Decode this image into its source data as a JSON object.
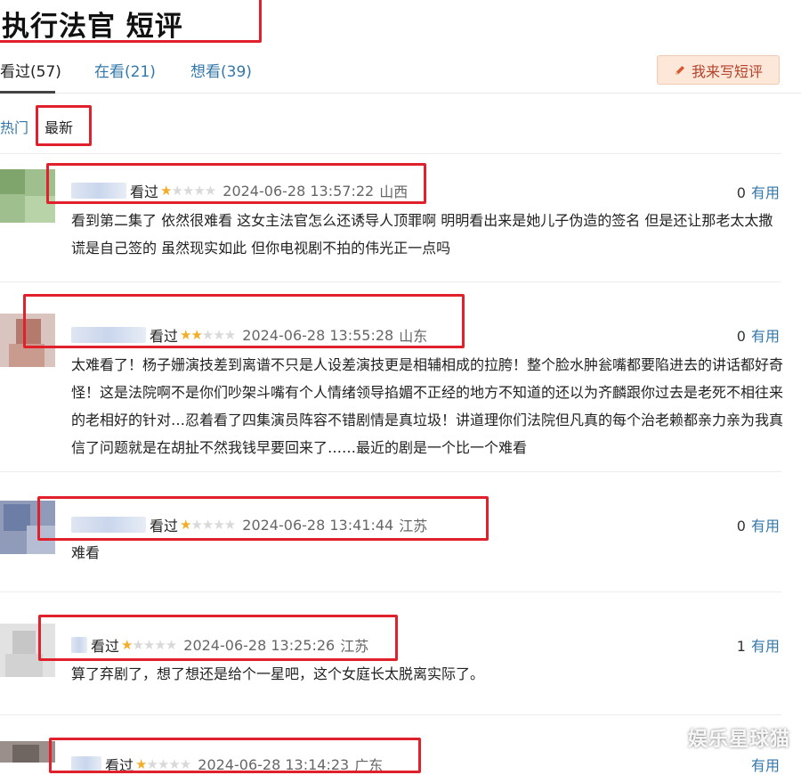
{
  "page": {
    "title": "执行法官 短评",
    "tabs": [
      {
        "label": "看过(57)",
        "active": true
      },
      {
        "label": "在看(21)",
        "active": false
      },
      {
        "label": "想看(39)",
        "active": false
      }
    ],
    "write_button": "我来写短评",
    "sort": {
      "hot": "热门",
      "new": "最新"
    },
    "watermark": "娱乐星球猫"
  },
  "colors": {
    "highlight_box": "#e0202a",
    "link": "#3377aa",
    "star_on": "#f2ad2a",
    "star_off": "#d9d9d9"
  },
  "comments": [
    {
      "status": "看过",
      "rating": 1,
      "time": "2024-06-28 13:57:22",
      "location": "山西",
      "useful_count": "0",
      "useful_label": "有用",
      "text": "看到第二集了 依然很难看 这女主法官怎么还诱导人顶罪啊 明明看出来是她儿子伪造的签名 但是还让那老太太撒谎是自己签的 虽然现实如此 但你电视剧不拍的伟光正一点吗"
    },
    {
      "status": "看过",
      "rating": 2,
      "time": "2024-06-28 13:55:28",
      "location": "山东",
      "useful_count": "0",
      "useful_label": "有用",
      "text": "太难看了！杨子姗演技差到离谱不只是人设差演技更是相辅相成的拉胯！整个脸水肿瓮嘴都要陷进去的讲话都好奇怪！这是法院啊不是你们吵架斗嘴有个人情绪领导掐媚不正经的地方不知道的还以为齐麟跟你过去是老死不相往来的老相好的针对…忍着看了四集演员阵容不错剧情是真垃圾！讲道理你们法院但凡真的每个治老赖都亲力亲为我真信了问题就是在胡扯不然我钱早要回来了……最近的剧是一个比一个难看"
    },
    {
      "status": "看过",
      "rating": 1,
      "time": "2024-06-28 13:41:44",
      "location": "江苏",
      "useful_count": "0",
      "useful_label": "有用",
      "text": "难看"
    },
    {
      "status": "看过",
      "rating": 1,
      "time": "2024-06-28 13:25:26",
      "location": "江苏",
      "useful_count": "1",
      "useful_label": "有用",
      "text": "算了弃剧了，想了想还是给个一星吧，这个女庭长太脱离实际了。"
    },
    {
      "status": "看过",
      "rating": 1,
      "time": "2024-06-28 13:14:23",
      "location": "广东",
      "useful_count": "",
      "useful_label": "有用",
      "text": ""
    }
  ]
}
